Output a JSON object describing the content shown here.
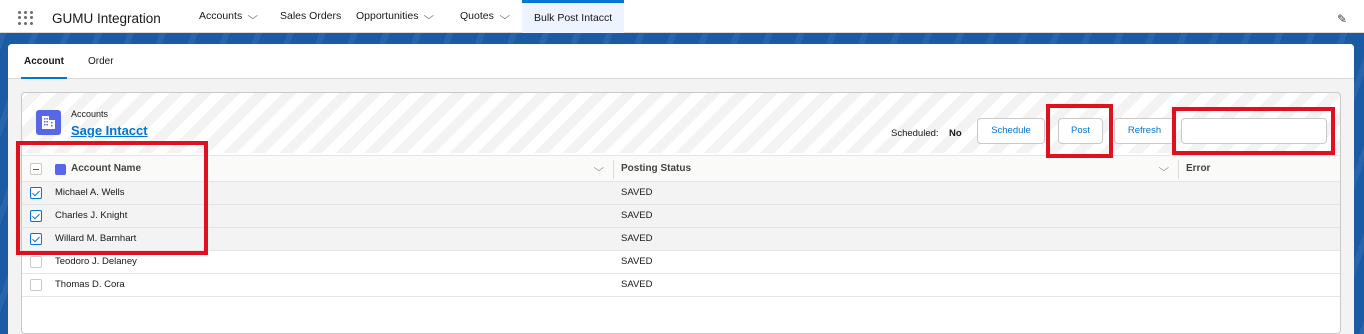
{
  "nav": {
    "app_name": "GUMU Integration",
    "items": [
      {
        "label": "Accounts",
        "has_menu": true
      },
      {
        "label": "Sales Orders",
        "has_menu": false
      },
      {
        "label": "Opportunities",
        "has_menu": true
      },
      {
        "label": "Quotes",
        "has_menu": true
      },
      {
        "label": "Bulk Post Intacct",
        "has_menu": false,
        "active": true
      }
    ],
    "chevron": "⌵",
    "edit_icon": "pencil-icon"
  },
  "tabs": [
    {
      "label": "Account",
      "active": true
    },
    {
      "label": "Order",
      "active": false
    }
  ],
  "card": {
    "object_label": "Accounts",
    "title": "Sage Intacct",
    "scheduled_label": "Scheduled:",
    "scheduled_value": "No",
    "buttons": {
      "schedule": "Schedule",
      "post": "Post",
      "refresh": "Refresh"
    },
    "search_value": ""
  },
  "table": {
    "columns": [
      "Account Name",
      "Posting Status",
      "Error"
    ],
    "rows": [
      {
        "name": "Michael A. Wells",
        "status": "SAVED",
        "error": "",
        "checked": true
      },
      {
        "name": "Charles J. Knight",
        "status": "SAVED",
        "error": "",
        "checked": true
      },
      {
        "name": "Willard M. Barnhart",
        "status": "SAVED",
        "error": "",
        "checked": true
      },
      {
        "name": "Teodoro J. Delaney",
        "status": "SAVED",
        "error": "",
        "checked": false
      },
      {
        "name": "Thomas D. Cora",
        "status": "SAVED",
        "error": "",
        "checked": false
      }
    ]
  },
  "colors": {
    "accent": "#0176d3",
    "highlight": "#e0111e",
    "band": "#1b5ba6",
    "object_icon": "#5867e8"
  }
}
